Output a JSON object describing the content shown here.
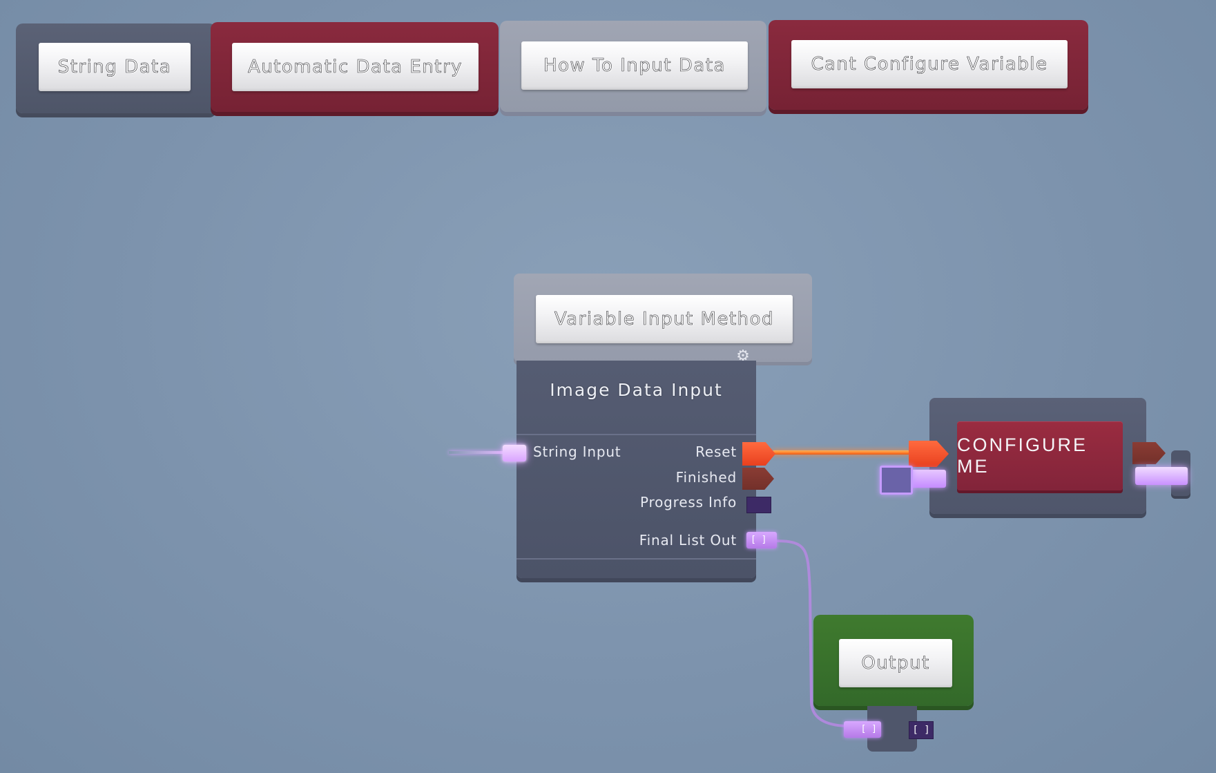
{
  "chips": {
    "string_data": "String Data",
    "automatic_data_entry": "Automatic Data Entry",
    "how_to_input_data": "How To Input Data",
    "cant_configure_variable": "Cant Configure Variable"
  },
  "variable_input_method": {
    "label": "Variable Input Method",
    "gear_glyph": "⚙"
  },
  "image_data_input": {
    "title": "Image Data Input",
    "inputs": {
      "string_input": "String Input"
    },
    "outputs": {
      "reset": "Reset",
      "finished": "Finished",
      "progress_info": "Progress Info",
      "final_list_out": "Final List Out",
      "final_list_glyph": "[ ]"
    }
  },
  "configure_node": {
    "label": "CONFIGURE ME"
  },
  "output_node": {
    "label": "Output",
    "in_glyph": "[ ]",
    "out_glyph": "[ ]"
  },
  "colors": {
    "background": "#7d93ad",
    "slab_gray": "#4f566b",
    "slab_red": "#7a2437",
    "slab_light": "#959bab",
    "slab_green": "#366c2b",
    "port_exec": "#ff5a2a",
    "port_list": "#c58cff",
    "port_progress": "#3d2a66"
  }
}
